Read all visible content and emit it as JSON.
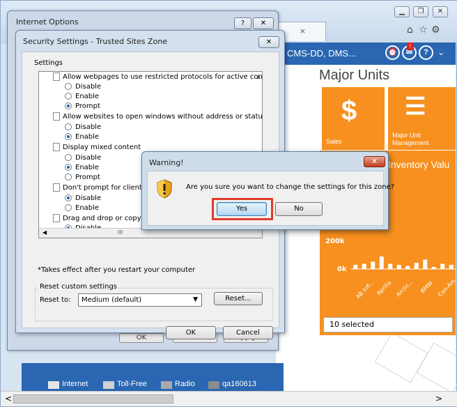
{
  "browser": {
    "tab_close": "×",
    "window_controls": [
      "minimize",
      "restore",
      "close"
    ],
    "toolbar_icons": [
      "home-icon",
      "star-icon",
      "gear-icon"
    ]
  },
  "page": {
    "site_label": "CMS-DD, DMS...",
    "title": "Major Units",
    "tiles": [
      {
        "label": "Sales",
        "icon": "dollar-icon"
      },
      {
        "label": "Major Unit Management",
        "label_line1": "Major Unit",
        "label_line2": "Management",
        "icon": "list-icon"
      }
    ],
    "inventory_title": "Inventory Valu",
    "chart_data": {
      "type": "bar",
      "title": "Inventory Valu",
      "y_ticks": [
        "200k",
        "0k"
      ],
      "categories": [
        "AB Infl...",
        "Aprilia",
        "Arctic...",
        "BMW",
        "Can-Am"
      ],
      "values": [
        20,
        25,
        35,
        60,
        25,
        20,
        15,
        30,
        45,
        10,
        25,
        20
      ]
    },
    "selector_value": "10 selected",
    "legend": [
      {
        "label": "Internet",
        "color": "#e6e6e6"
      },
      {
        "label": "Toll-Free",
        "color": "#d0d0d0"
      },
      {
        "label": "Radio",
        "color": "#a9a9a9"
      },
      {
        "label": "qa160613",
        "color": "#8c8c8c"
      }
    ],
    "hscroll_left": "<",
    "hscroll_right": ">"
  },
  "internet_options": {
    "title": "Internet Options",
    "help_btn": "?",
    "close_btn": "✕",
    "footer_buttons": [
      "OK",
      "Cancel",
      "Apply"
    ]
  },
  "security_settings": {
    "title": "Security Settings - Trusted Sites Zone",
    "close_btn": "✕",
    "settings_label": "Settings",
    "list": [
      {
        "kind": "header",
        "text": "Allow webpages to use restricted protocols for active conten"
      },
      {
        "kind": "option",
        "text": "Disable",
        "checked": false
      },
      {
        "kind": "option",
        "text": "Enable",
        "checked": false
      },
      {
        "kind": "option",
        "text": "Prompt",
        "checked": true
      },
      {
        "kind": "header",
        "text": "Allow websites to open windows without address or status ba"
      },
      {
        "kind": "option",
        "text": "Disable",
        "checked": false
      },
      {
        "kind": "option",
        "text": "Enable",
        "checked": true
      },
      {
        "kind": "header",
        "text": "Display mixed content"
      },
      {
        "kind": "option",
        "text": "Disable",
        "checked": false
      },
      {
        "kind": "option",
        "text": "Enable",
        "checked": true
      },
      {
        "kind": "option",
        "text": "Prompt",
        "checked": false
      },
      {
        "kind": "header",
        "text": "Don't prompt for client ce"
      },
      {
        "kind": "option",
        "text": "Disable",
        "checked": true
      },
      {
        "kind": "option",
        "text": "Enable",
        "checked": false
      },
      {
        "kind": "header",
        "text": "Drag and drop or copy ar"
      },
      {
        "kind": "option",
        "text": "Disable",
        "checked": true
      }
    ],
    "hscroll_thumb": "III",
    "takes_effect": "*Takes effect after you restart your computer",
    "reset_group_label": "Reset custom settings",
    "reset_to_label": "Reset to:",
    "reset_select_value": "Medium (default)",
    "reset_button": "Reset...",
    "ok_button": "OK",
    "cancel_button": "Cancel"
  },
  "warning": {
    "title": "Warning!",
    "close_btn": "✕",
    "message": "Are you sure you want to change the settings for this zone?",
    "yes_button": "Yes",
    "no_button": "No"
  }
}
